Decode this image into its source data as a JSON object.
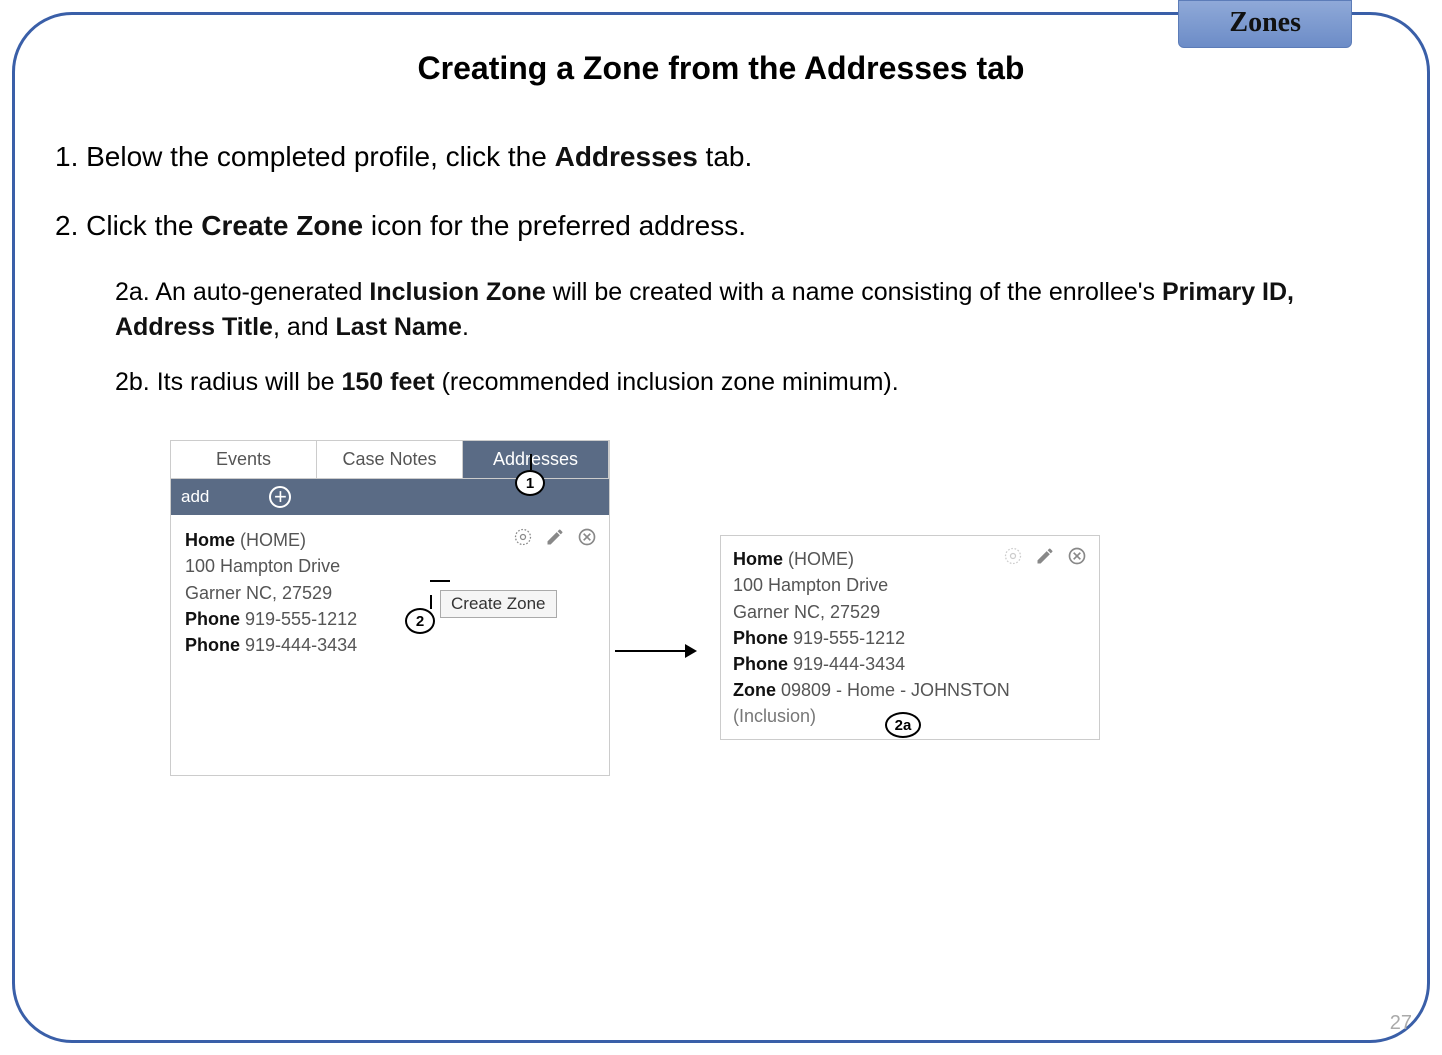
{
  "header": {
    "zone_tab": "Zones",
    "title": "Creating a Zone from the Addresses tab"
  },
  "steps": {
    "s1_pre": "1.  Below the completed profile, click the ",
    "s1_bold": "Addresses",
    "s1_post": " tab.",
    "s2_pre": "2.  Click the ",
    "s2_bold": "Create Zone",
    "s2_post": " icon for the preferred address.",
    "s2a_pre": "2a. An auto-generated ",
    "s2a_b1": "Inclusion Zone",
    "s2a_mid": " will be created with a name consisting of the enrollee's ",
    "s2a_b2": "Primary ID, Address Title",
    "s2a_mid2": ", and ",
    "s2a_b3": "Last Name",
    "s2a_post": ".",
    "s2b_pre": "2b. Its radius will be ",
    "s2b_bold": "150 feet",
    "s2b_post": " (recommended inclusion zone minimum)."
  },
  "ui": {
    "tabs": {
      "events": "Events",
      "casenotes": "Case Notes",
      "addresses": "Addresses"
    },
    "add": "add",
    "tooltip": "Create Zone",
    "addr": {
      "title_bold": "Home",
      "title_paren": " (HOME)",
      "line1": "100 Hampton Drive",
      "line2": "Garner NC, 27529",
      "phone_label": "Phone",
      "phone1": " 919-555-1212",
      "phone2": " 919-444-3434",
      "zone_label": "Zone",
      "zone_val": " 09809 - Home - JOHNSTON",
      "inclusion": "(Inclusion)"
    }
  },
  "callouts": {
    "c1": "1",
    "c2": "2",
    "c2a": "2a"
  },
  "page": "27"
}
